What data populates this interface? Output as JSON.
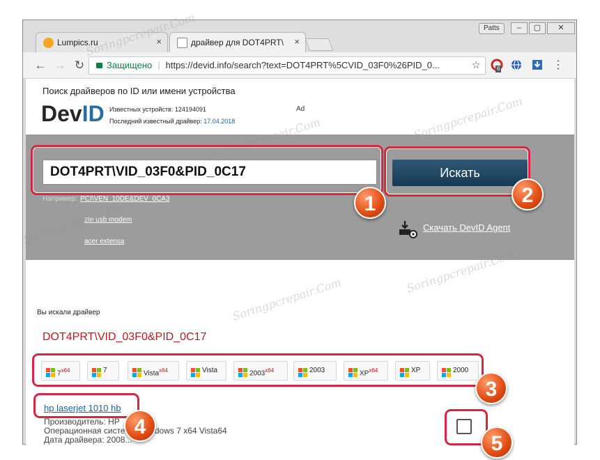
{
  "browser": {
    "profile": "Patts",
    "window_buttons": [
      "–",
      "▢",
      "✕"
    ],
    "tabs": [
      {
        "title": "Lumpics.ru",
        "close": "×"
      },
      {
        "title": "драйвер для DOT4PRT\\",
        "close": "×"
      }
    ],
    "omnibox": {
      "secure_label": "Защищено",
      "url": "https://devid.info/search?text=DOT4PRT%5CVID_03F0%26PID_0..."
    },
    "ext_badge": "6"
  },
  "site": {
    "tagline": "Поиск драйверов по ID или имени устройства",
    "logo_dev": "Dev",
    "logo_id": "ID",
    "known_devices_label": "Известных устройств:",
    "known_devices_value": "124194091",
    "last_driver_label": "Последний известный драйвер:",
    "last_driver_value": "17.04.2018",
    "ad": "Ad"
  },
  "search": {
    "query": "DOT4PRT\\VID_03F0&PID_0C17",
    "button": "Искать",
    "example_label": "Например:",
    "example_value": "PCI\\VEN_10DE&DEV_0CA3",
    "suggestions": [
      "zte usb modem",
      "acer extensa"
    ],
    "agent_link": "Скачать DevID Agent"
  },
  "results": {
    "searched_label": "Вы искали драйвер",
    "title": "DOT4PRT\\VID_03F0&PID_0C17",
    "os_buttons": [
      {
        "label": "7",
        "sup": "x64"
      },
      {
        "label": "7",
        "sup": ""
      },
      {
        "label": "Vista",
        "sup": "x64"
      },
      {
        "label": "Vista",
        "sup": ""
      },
      {
        "label": "2003",
        "sup": "x64"
      },
      {
        "label": "2003",
        "sup": ""
      },
      {
        "label": "XP",
        "sup": "x64"
      },
      {
        "label": "XP",
        "sup": ""
      },
      {
        "label": "2000",
        "sup": ""
      }
    ],
    "driver_link": "hp laserjet 1010 hb",
    "meta_lines": [
      "Производитель: HP",
      "Операционная система: Windows 7 x64 Vista64",
      "Дата драйвера: 2008..."
    ]
  },
  "annotations": [
    "1",
    "2",
    "3",
    "4",
    "5"
  ],
  "watermark": "Soringpcrepair.Com",
  "colors": {
    "annotation_red": "#d7263d",
    "search_button": "#1f4a6b",
    "result_red": "#c4161c",
    "link_blue": "#1f5fa0",
    "band_gray": "#9c9c9c"
  }
}
